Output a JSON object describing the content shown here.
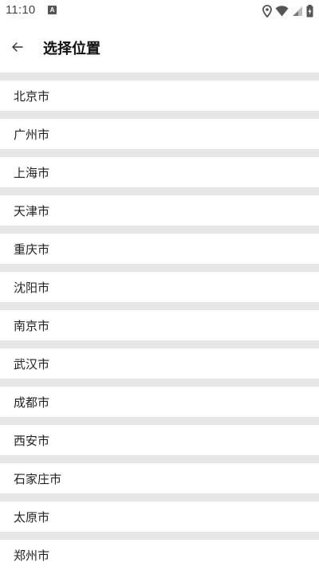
{
  "status_bar": {
    "time": "11:10",
    "notification_icon_letter": "A"
  },
  "header": {
    "title": "选择位置",
    "back_icon": "arrow-left-icon"
  },
  "cities": [
    "北京市",
    "广州市",
    "上海市",
    "天津市",
    "重庆市",
    "沈阳市",
    "南京市",
    "武汉市",
    "成都市",
    "西安市",
    "石家庄市",
    "太原市",
    "郑州市"
  ],
  "colors": {
    "divider": "#e6e6e6",
    "text": "#222222",
    "background": "#ffffff"
  }
}
